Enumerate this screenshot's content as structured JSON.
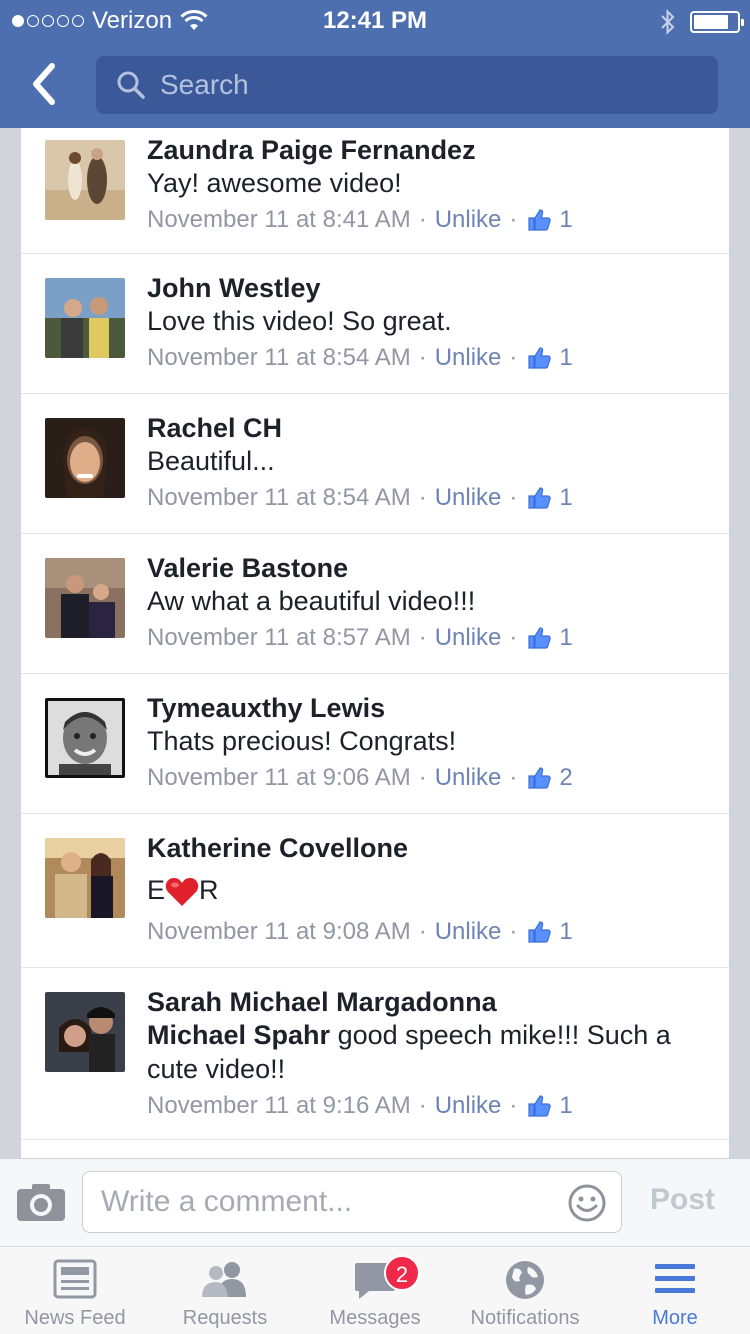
{
  "status_bar": {
    "carrier": "Verizon",
    "time": "12:41 PM"
  },
  "header": {
    "search_placeholder": "Search"
  },
  "comments": [
    {
      "name": "Zaundra Paige Fernandez",
      "text": "Yay! awesome video!",
      "tagged": "",
      "time": "November 11 at 8:41 AM",
      "action": "Unlike",
      "likes": "1",
      "avatar_colors": [
        "#c9b79a",
        "#e8d8c4",
        "#5a4633"
      ]
    },
    {
      "name": "John Westley",
      "text": "Love this video! So great.",
      "tagged": "",
      "time": "November 11 at 8:54 AM",
      "action": "Unlike",
      "likes": "1",
      "avatar_colors": [
        "#6a8fb5",
        "#d8c06a",
        "#3c4a3a"
      ]
    },
    {
      "name": "Rachel CH",
      "text": "Beautiful...",
      "tagged": "",
      "time": "November 11 at 8:54 AM",
      "action": "Unlike",
      "likes": "1",
      "avatar_colors": [
        "#3a2a22",
        "#d8a47e",
        "#1a1210"
      ]
    },
    {
      "name": "Valerie Bastone",
      "text": "Aw what a beautiful video!!!",
      "tagged": "",
      "time": "November 11 at 8:57 AM",
      "action": "Unlike",
      "likes": "1",
      "avatar_colors": [
        "#8a6a5a",
        "#2a2430",
        "#c8a08a"
      ]
    },
    {
      "name": "Tymeauxthy Lewis",
      "text": "Thats precious! Congrats!",
      "tagged": "",
      "time": "November 11 at 9:06 AM",
      "action": "Unlike",
      "likes": "2",
      "avatar_colors": [
        "#222222",
        "#777777",
        "#e8e8e8"
      ]
    },
    {
      "name": "Katherine Covellone",
      "text_before": "E",
      "text_after": "R",
      "tagged": "",
      "time": "November 11 at 9:08 AM",
      "action": "Unlike",
      "likes": "1",
      "avatar_colors": [
        "#c4a46a",
        "#1e1a2a",
        "#d8b090"
      ]
    },
    {
      "name": "Sarah Michael Margadonna",
      "tagged": "Michael Spahr",
      "text": " good speech mike!!! Such a cute video!!",
      "time": "November 11 at 9:16 AM",
      "action": "Unlike",
      "likes": "1",
      "avatar_colors": [
        "#3a3f4a",
        "#c8a088",
        "#1a1a22"
      ]
    }
  ],
  "composer": {
    "placeholder": "Write a comment...",
    "post_label": "Post"
  },
  "tabs": [
    {
      "label": "News Feed",
      "icon": "news-feed-icon"
    },
    {
      "label": "Requests",
      "icon": "requests-icon"
    },
    {
      "label": "Messages",
      "icon": "messages-icon",
      "badge": "2"
    },
    {
      "label": "Notifications",
      "icon": "globe-icon"
    },
    {
      "label": "More",
      "icon": "menu-icon",
      "active": true
    }
  ],
  "colors": {
    "header_bg": "#4d6fb0",
    "search_bg": "#3b5998",
    "link": "#6d84b4",
    "active_tab": "#4a78d9",
    "badge": "#f02849"
  }
}
